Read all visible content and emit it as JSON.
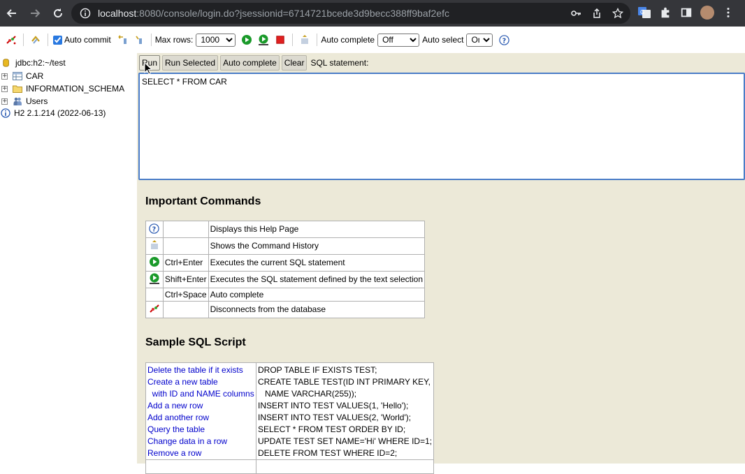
{
  "browser": {
    "url_host": "localhost",
    "url_path": ":8080/console/login.do?jsessionid=6714721bcede3d9becc388ff9baf2efc"
  },
  "toolbar": {
    "auto_commit_label": "Auto commit",
    "auto_commit_checked": true,
    "max_rows_label": "Max rows:",
    "max_rows_value": "1000",
    "auto_complete_label": "Auto complete",
    "auto_complete_value": "Off",
    "auto_select_label": "Auto select",
    "auto_select_value": "On"
  },
  "tree": {
    "connection": "jdbc:h2:~/test",
    "items": [
      "CAR",
      "INFORMATION_SCHEMA",
      "Users"
    ],
    "version": "H2 2.1.214 (2022-06-13)"
  },
  "sql": {
    "buttons": [
      "Run",
      "Run Selected",
      "Auto complete",
      "Clear"
    ],
    "label": "SQL statement:",
    "text": "SELECT * FROM CAR"
  },
  "help": {
    "commands_title": "Important Commands",
    "commands": [
      {
        "icon": "help-icon",
        "key": "",
        "desc": "Displays this Help Page"
      },
      {
        "icon": "history-icon",
        "key": "",
        "desc": "Shows the Command History"
      },
      {
        "icon": "run-icon",
        "key": "Ctrl+Enter",
        "desc": "Executes the current SQL statement"
      },
      {
        "icon": "run-selected-icon",
        "key": "Shift+Enter",
        "desc": "Executes the SQL statement defined by the text selection"
      },
      {
        "icon": "",
        "key": "Ctrl+Space",
        "desc": "Auto complete"
      },
      {
        "icon": "disconnect-icon",
        "key": "",
        "desc": "Disconnects from the database"
      }
    ],
    "sample_title": "Sample SQL Script",
    "sample": {
      "links": [
        "Delete the table if it exists",
        "Create a new table",
        "  with ID and NAME columns",
        "Add a new row",
        "Add another row",
        "Query the table",
        "Change data in a row",
        "Remove a row"
      ],
      "sql": [
        "DROP TABLE IF EXISTS TEST;",
        "CREATE TABLE TEST(ID INT PRIMARY KEY,",
        "   NAME VARCHAR(255));",
        "INSERT INTO TEST VALUES(1, 'Hello');",
        "INSERT INTO TEST VALUES(2, 'World');",
        "SELECT * FROM TEST ORDER BY ID;",
        "UPDATE TEST SET NAME='Hi' WHERE ID=1;",
        "DELETE FROM TEST WHERE ID=2;"
      ]
    }
  }
}
